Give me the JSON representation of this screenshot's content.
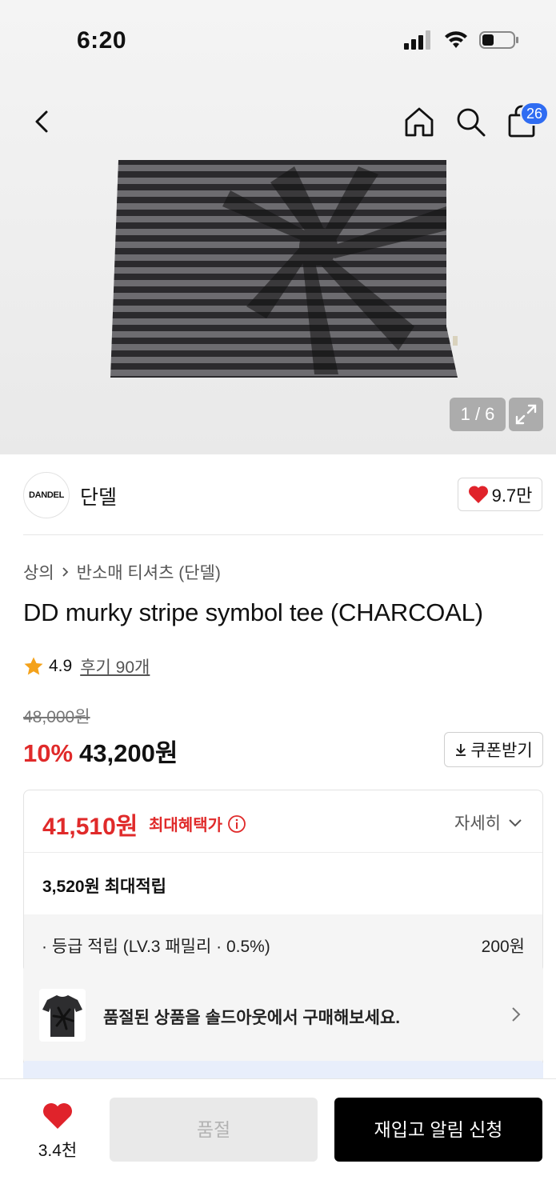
{
  "status_bar": {
    "time": "6:20"
  },
  "nav": {
    "cart_count": "26"
  },
  "gallery": {
    "counter": "1 / 6"
  },
  "brand": {
    "logo_text": "DANDEL",
    "name": "단델",
    "likes": "9.7만"
  },
  "breadcrumb": {
    "category": "상의",
    "subcategory": "반소매 티셔츠 (단델)"
  },
  "product": {
    "title": "DD murky stripe symbol tee (CHARCOAL)",
    "rating": "4.9",
    "reviews": "후기 90개",
    "original_price": "48,000원",
    "discount": "10%",
    "price": "43,200원",
    "coupon_label": "쿠폰받기"
  },
  "benefit": {
    "max_price": "41,510원",
    "max_label": "최대혜택가",
    "detail_label": "자세히",
    "points_title": "3,520원 최대적립",
    "points_rows": [
      {
        "label": "· 등급 적립 (LV.3 패밀리 · 0.5%)",
        "value": "200원"
      }
    ]
  },
  "soldout_banner": {
    "text": "품절된 상품을 솔드아웃에서 구매해보세요."
  },
  "bottom_bar": {
    "wish_count": "3.4천",
    "soldout_label": "품절",
    "restock_label": "재입고 알림 신청"
  },
  "colors": {
    "accent_red": "#e02a2a",
    "badge_blue": "#2f6cf2"
  }
}
